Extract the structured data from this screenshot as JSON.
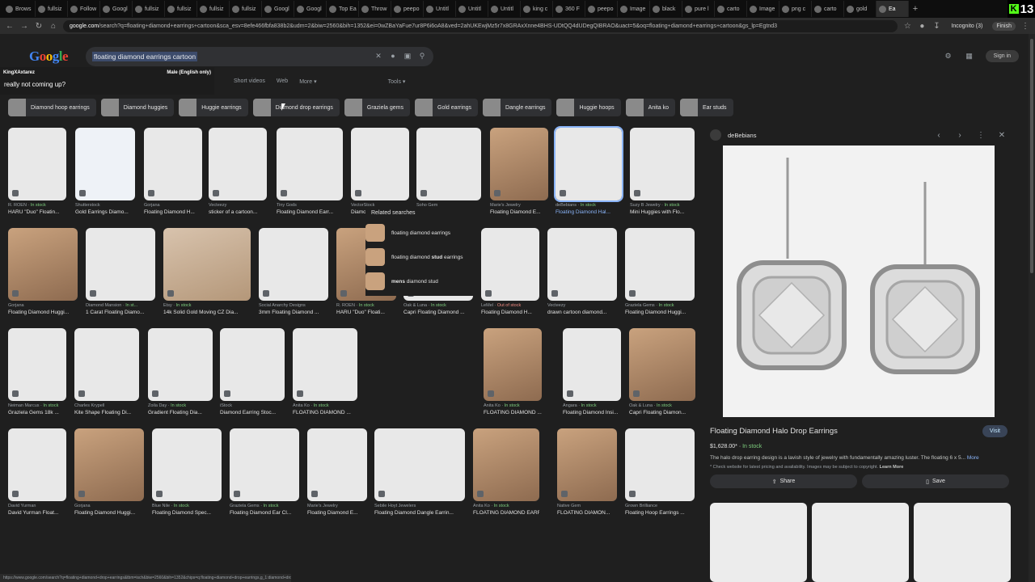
{
  "browser": {
    "tabs": [
      "Brows",
      "fullsiz",
      "Follow",
      "Googl",
      "fullsiz",
      "fullsiz",
      "fullsiz",
      "fullsiz",
      "Googl",
      "Googl",
      "Top Ea",
      "Throw",
      "peepo",
      "Untitl",
      "Untitl",
      "Untitl",
      "king c",
      "360 F",
      "peepo",
      "Image",
      "black",
      "pure l",
      "carto",
      "Image",
      "png c",
      "carto",
      "gold",
      "Ea"
    ],
    "active_tab_index": 27,
    "url_domain": "google.com",
    "url_rest": "/search?q=floating+diamond+earrings+cartoon&sca_esv=8efe466fbfa838b2&udm=2&biw=2560&bih=1352&ei=0wZBaYaFue7ur8P6i6oA8&ved=2ahUKEwjMz5r7x8GRAxXnne4BHS-UDtQQ4dUDegQIBRAO&uact=5&oq=floating+diamond+earrings+cartoon&gs_lp=Egtnd3",
    "incognito_label": "Incognito (3)",
    "finish_label": "Finish"
  },
  "kick_badge": {
    "k": "K",
    "count": "13"
  },
  "google": {
    "logo": "Google",
    "query": "floating diamond earrings cartoon",
    "signin": "Sign in",
    "tabs": [
      "Short videos",
      "Web",
      "More",
      "Tools"
    ]
  },
  "stream_chat": {
    "user": "KingXAxtarez",
    "filter": "Male (English only)",
    "message": "really not coming up?"
  },
  "chips": [
    "Diamond hoop earrings",
    "Diamond huggies",
    "Huggie earrings",
    "Diamond drop earrings",
    "Graziela gems",
    "Gold earrings",
    "Dangle earrings",
    "Huggie hoops",
    "Anita ko",
    "Ear studs"
  ],
  "results": [
    {
      "src": "R. ROEN",
      "stock": "In stock",
      "title": "HARU \"Duo\" Floatin..."
    },
    {
      "src": "Shutterstock",
      "stock": "",
      "title": "Gold Earrings Diamo..."
    },
    {
      "src": "Gorjana",
      "stock": "",
      "title": "Floating Diamond H..."
    },
    {
      "src": "Vecteezy",
      "stock": "",
      "title": "sticker of a cartoon..."
    },
    {
      "src": "Tiny Gods",
      "stock": "",
      "title": "Floating Diamond Earr..."
    },
    {
      "src": "VectorStock",
      "stock": "",
      "title": "Diamond earring ca..."
    },
    {
      "src": "Soho Gem",
      "stock": "",
      "title": "Floating Diamond Line..."
    },
    {
      "src": "Marie's Jewelry",
      "stock": "",
      "title": "Floating Diamond E..."
    },
    {
      "src": "deBebians",
      "stock": "In stock",
      "title": "Floating Diamond Hal..."
    },
    {
      "src": "Suzy B Jewelry",
      "stock": "In stock",
      "title": "Mini Huggies with Flo..."
    },
    {
      "src": "Gorjana",
      "stock": "",
      "title": "Floating Diamond Huggi..."
    },
    {
      "src": "Diamond Mansion",
      "stock": "In st...",
      "title": "1 Carat Floating Diamo..."
    },
    {
      "src": "Etsy",
      "stock": "In stock",
      "title": "14k Solid Gold Moving CZ Dia..."
    },
    {
      "src": "Social Anarchy Designs",
      "stock": "",
      "title": "3mm Floating Diamond ..."
    },
    {
      "src": "R. ROEN",
      "stock": "In stock",
      "title": "HARU \"Duo\" Floati..."
    },
    {
      "src": "Oak & Luna",
      "stock": "In stock",
      "title": "Capri Floating Diamond ..."
    },
    {
      "src": "LeMel",
      "stock_oos": "Out of stock",
      "title": "Floating Diamond H..."
    },
    {
      "src": "Vecteezy",
      "stock": "",
      "title": "drawn cartoon diamond..."
    },
    {
      "src": "Graziela Gems",
      "stock": "In stock",
      "title": "Floating Diamond Huggi..."
    },
    {
      "src": "Neiman Marcus",
      "stock": "In stock",
      "title": "Graziela Gems 18k ..."
    },
    {
      "src": "Charles Krypell",
      "stock": "",
      "title": "Kite Shape Floating Di..."
    },
    {
      "src": "Zoila Day",
      "stock": "In stock",
      "title": "Gradient Floating Dia..."
    },
    {
      "src": "iStock",
      "stock": "",
      "title": "Diamond Earring Stoc..."
    },
    {
      "src": "Anita Ko",
      "stock": "In stock",
      "title": "FLOATING DIAMOND ..."
    },
    {
      "src": "Anita Ko",
      "stock": "In stock",
      "title": "FLOATING DIAMOND ..."
    },
    {
      "src": "Angara",
      "stock": "In stock",
      "title": "Floating Diamond Insi..."
    },
    {
      "src": "Oak & Luna",
      "stock": "In stock",
      "title": "Capri Floating Diamon..."
    },
    {
      "src": "David Yurman",
      "stock": "",
      "title": "David Yurman Float..."
    },
    {
      "src": "Gorjana",
      "stock": "",
      "title": "Floating Diamond Huggi..."
    },
    {
      "src": "Blue Nile",
      "stock": "In stock",
      "title": "Floating Diamond Spec..."
    },
    {
      "src": "Graziela Gems",
      "stock": "In stock",
      "title": "Floating Diamond Ear Cl..."
    },
    {
      "src": "Marie's Jewelry",
      "stock": "",
      "title": "Floating Diamond E..."
    },
    {
      "src": "Sebile Hoyt Jewelers",
      "stock": "",
      "title": "Floating Diamond Dangle Earrin..."
    },
    {
      "src": "Anita Ko",
      "stock": "In stock",
      "title": "FLOATING DIAMOND EARR..."
    },
    {
      "src": "Native Gem",
      "stock": "",
      "title": "FLOATING DIAMON..."
    },
    {
      "src": "Grown Brilliance",
      "stock": "",
      "title": "Floating Hoop Earrings ..."
    }
  ],
  "related": {
    "heading": "Related searches",
    "items": [
      {
        "pre": "floating diamond earrings",
        "bold": "",
        "post": ""
      },
      {
        "pre": "floating diamond ",
        "bold": "stud",
        "post": " earrings"
      },
      {
        "pre": "",
        "bold": "mens",
        "post": " diamond stud"
      }
    ]
  },
  "panel": {
    "source": "deBebians",
    "title": "Floating Diamond Halo Drop Earrings",
    "visit": "Visit",
    "price": "$1,628.00*",
    "stock": "In stock",
    "description": "The halo drop earring design is a lavish style of jewelry with fundamentally amazing luster. The floating 6 x 5...",
    "more": "More",
    "note_pre": "* Check website for latest pricing and availability. Images may be subject to copyright. ",
    "note_link": "Learn More",
    "share": "Share",
    "save": "Save"
  },
  "statusbar": "https://www.google.com/search?q=floating+diamond+drop+earrings&tbm=isch&biw=2560&bih=1352&chips=q:floating+diamond+drop+earrings,g_1:diamond+drop+earrings",
  "colors": {
    "accent": "#8ab4f8",
    "in_stock": "#7ecf7e",
    "out_of_stock": "#f28b82",
    "kick": "#53fc18"
  }
}
